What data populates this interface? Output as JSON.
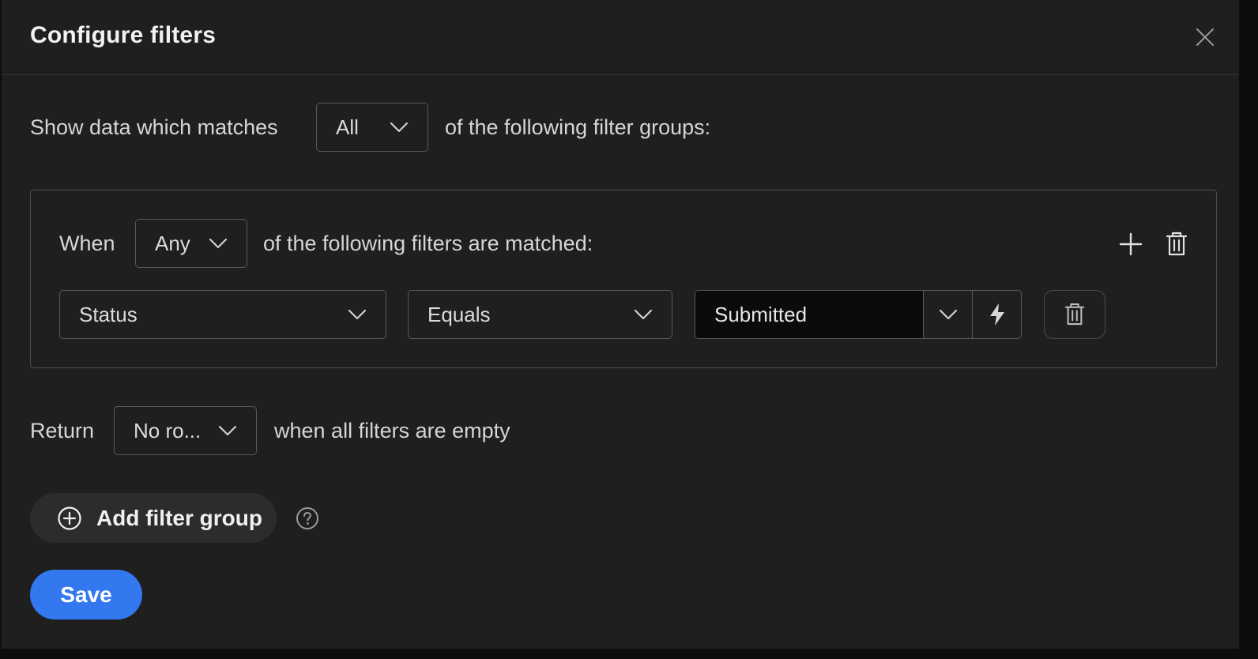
{
  "modal": {
    "title": "Configure filters"
  },
  "match_row": {
    "prefix": "Show data which matches",
    "selected": "All",
    "suffix": "of the following filter groups:"
  },
  "filter_group": {
    "prefix": "When",
    "selected": "Any",
    "suffix": "of the following filters are matched:",
    "filters": [
      {
        "field": "Status",
        "operator": "Equals",
        "value": "Submitted"
      }
    ]
  },
  "return_row": {
    "prefix": "Return",
    "selected": "No ro...",
    "suffix": "when all filters are empty"
  },
  "actions": {
    "add_filter_group_label": "Add filter group",
    "save_label": "Save"
  },
  "icons": {
    "close": "close-icon",
    "chevron": "chevron-down-icon",
    "add": "plus-icon",
    "delete": "trash-icon",
    "dynamic": "lightning-icon",
    "add_circle": "plus-circle-icon",
    "help": "help-circle-icon"
  },
  "colors": {
    "background": "#1f1f1f",
    "primary": "#3478f0",
    "border": "#5a5a5a",
    "input_bg": "#0b0b0b"
  }
}
